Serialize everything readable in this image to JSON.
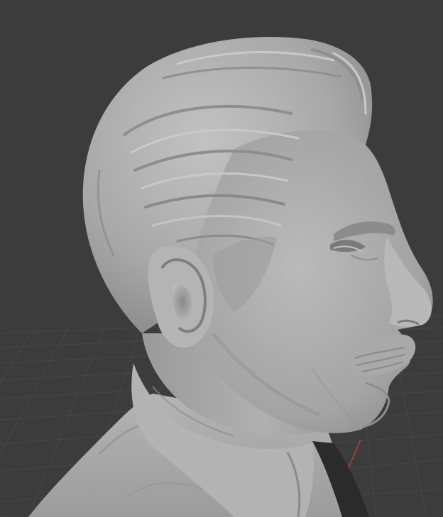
{
  "viewport": {
    "background_color": "#3c3c3c",
    "grid_line_color": "#484848",
    "grid_axis_x_color": "#c0393b",
    "mesh_color": "#a9a9a9",
    "mesh_shadow_color": "#7d7d7d",
    "mesh_highlight_color": "#c6c6c6",
    "dark_cloth_color": "#2a2a2a",
    "object": "sculpted-head-bust"
  }
}
